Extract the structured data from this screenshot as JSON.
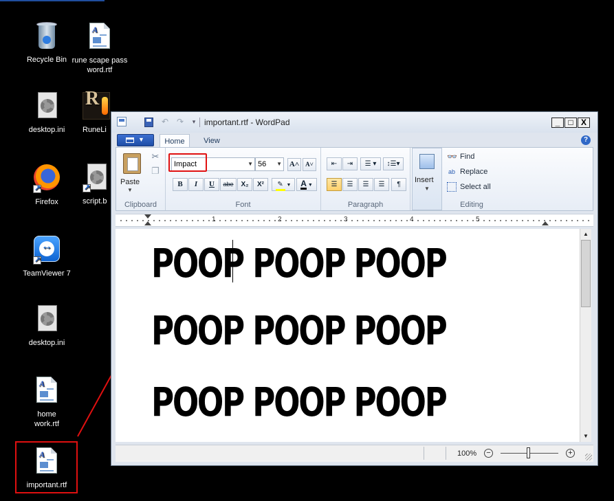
{
  "desktop": {
    "icons": [
      {
        "label": "Recycle Bin",
        "icon": "recycle-bin-icon"
      },
      {
        "label": "rune scape pass word.rtf",
        "icon": "rtf-document-icon"
      },
      {
        "label": "desktop.ini",
        "icon": "settings-file-icon"
      },
      {
        "label": "RuneLi",
        "icon": "runelite-icon"
      },
      {
        "label": "Firefox",
        "icon": "firefox-icon"
      },
      {
        "label": "script.b",
        "icon": "settings-file-icon"
      },
      {
        "label": "TeamViewer 7",
        "icon": "teamviewer-icon"
      },
      {
        "label": "desktop.ini",
        "icon": "settings-file-icon"
      },
      {
        "label": "home work.rtf",
        "icon": "rtf-document-icon"
      },
      {
        "label": "important.rtf",
        "icon": "rtf-document-icon"
      }
    ],
    "highlight_color": "#e01010"
  },
  "window": {
    "title": "important.rtf - WordPad",
    "buttons": {
      "minimize": "_",
      "maximize": "□",
      "close": "X"
    }
  },
  "ribbon": {
    "tabs": [
      "Home",
      "View"
    ],
    "active_tab": "Home",
    "clipboard": {
      "paste": "Paste",
      "group_label": "Clipboard"
    },
    "font": {
      "family": "Impact",
      "size": "56",
      "grow": "A˄",
      "shrink": "A˅",
      "bold": "B",
      "italic": "I",
      "underline": "U",
      "strike": "abe",
      "subscript": "X₂",
      "superscript": "X²",
      "highlight_color": "#ffff00",
      "text_color": "#000000",
      "group_label": "Font"
    },
    "paragraph": {
      "group_label": "Paragraph"
    },
    "insert": {
      "label": "Insert"
    },
    "editing": {
      "find": "Find",
      "replace": "Replace",
      "select_all": "Select all",
      "group_label": "Editing"
    }
  },
  "ruler": {
    "numbers": [
      "1",
      "2",
      "3",
      "4",
      "5"
    ]
  },
  "document": {
    "lines": [
      "POOP POOP POOP",
      "POOP POOP POOP",
      "POOP POOP POOP"
    ]
  },
  "statusbar": {
    "zoom": "100%",
    "zoom_out": "−",
    "zoom_in": "+"
  }
}
